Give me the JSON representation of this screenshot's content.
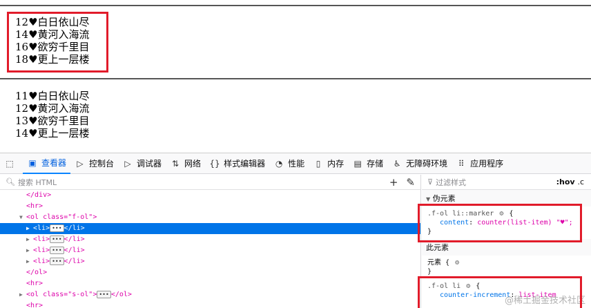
{
  "ordered_list_1": [
    "12♥白日依山尽",
    "14♥黄河入海流",
    "16♥欲穷千里目",
    "18♥更上一层楼"
  ],
  "ordered_list_2": [
    "11♥白日依山尽",
    "12♥黄河入海流",
    "13♥欲穷千里目",
    "14♥更上一层楼"
  ],
  "devtools": {
    "tabs": [
      {
        "name": "pick",
        "label": ""
      },
      {
        "name": "inspector",
        "label": "查看器"
      },
      {
        "name": "console",
        "label": "控制台"
      },
      {
        "name": "debugger",
        "label": "调试器"
      },
      {
        "name": "network",
        "label": "网络"
      },
      {
        "name": "style-editor",
        "label": "样式编辑器"
      },
      {
        "name": "performance",
        "label": "性能"
      },
      {
        "name": "memory",
        "label": "内存"
      },
      {
        "name": "storage",
        "label": "存储"
      },
      {
        "name": "accessibility",
        "label": "无障碍环境"
      },
      {
        "name": "application",
        "label": "应用程序"
      }
    ],
    "search_placeholder": "搜索 HTML",
    "filter_placeholder": "过滤样式",
    "hov_label": ":hov",
    "cls_label": ".c",
    "tree": [
      {
        "indent": 2,
        "text": "</div>",
        "kind": "close"
      },
      {
        "indent": 2,
        "text": "<hr>",
        "kind": "tag"
      },
      {
        "indent": 1,
        "text": "<ol class=\"f-ol\">",
        "kind": "open"
      },
      {
        "indent": 2,
        "text": "<li>",
        "kind": "li",
        "selected": true
      },
      {
        "indent": 2,
        "text": "<li>",
        "kind": "li"
      },
      {
        "indent": 2,
        "text": "<li>",
        "kind": "li"
      },
      {
        "indent": 2,
        "text": "<li>",
        "kind": "li"
      },
      {
        "indent": 2,
        "text": "</ol>",
        "kind": "close"
      },
      {
        "indent": 2,
        "text": "<hr>",
        "kind": "tag"
      },
      {
        "indent": 1,
        "text": "<ol class=\"s-ol\">",
        "kind": "collapsed"
      },
      {
        "indent": 2,
        "text": "<hr>",
        "kind": "tag"
      }
    ],
    "rules": {
      "pseudo_title": "伪元素",
      "pseudo_selector": ".f-ol li::marker",
      "pseudo_prop": "content",
      "pseudo_value": "counter(list-item) \"♥\";",
      "this_element_title": "此元素",
      "element_selector": "元素 {",
      "close_brace": "}",
      "rule2_selector": ".f-ol li",
      "rule2_prop": "counter-increment",
      "rule2_value": "list-item"
    },
    "watermark": "@稀土掘金技术社区"
  }
}
